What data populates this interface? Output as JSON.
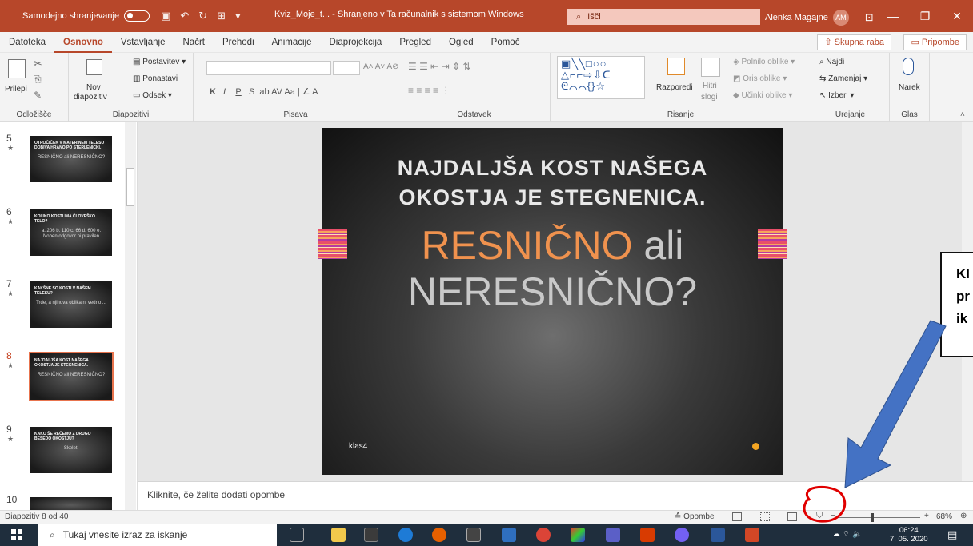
{
  "titlebar": {
    "autosave_label": "Samodejno shranjevanje",
    "doc_title": "Kviz_Moje_t... - Shranjeno v Ta računalnik s sistemom Windows",
    "search_placeholder": "Išči",
    "user_name": "Alenka Magajne",
    "user_initials": "AM"
  },
  "tabs": [
    "Datoteka",
    "Osnovno",
    "Vstavljanje",
    "Načrt",
    "Prehodi",
    "Animacije",
    "Diaprojekcija",
    "Pregled",
    "Ogled",
    "Pomoč"
  ],
  "active_tab": "Osnovno",
  "share_label": "Skupna raba",
  "comments_label": "Pripombe",
  "ribbon": {
    "clipboard": {
      "paste": "Prilepi",
      "label": "Odložišče"
    },
    "slides": {
      "new_slide": "Nov",
      "new_slide2": "diapozitiv",
      "layout": "Postavitev",
      "reset": "Ponastavi",
      "section": "Odsek",
      "label": "Diapozitivi"
    },
    "font": {
      "label": "Pisava",
      "bold": "K",
      "italic": "L",
      "underline": "P",
      "strike": "S"
    },
    "paragraph": {
      "label": "Odstavek"
    },
    "drawing": {
      "arrange": "Razporedi",
      "quick_styles": "Hitri",
      "quick_styles2": "slogi",
      "fill": "Polnilo oblike",
      "outline": "Oris oblike",
      "effects": "Učinki oblike",
      "label": "Risanje"
    },
    "editing": {
      "find": "Najdi",
      "replace": "Zamenjaj",
      "select": "Izberi",
      "label": "Urejanje"
    },
    "voice": {
      "dictate": "Narek",
      "label": "Glas"
    }
  },
  "thumbnails": [
    {
      "num": "5",
      "text": "OTROČIČEK V MATERINEM TELESU DOBIVA HRANO PO STERLENIČKI.",
      "sub": "RESNIČNO ali NERESNIČNO?"
    },
    {
      "num": "6",
      "text": "KOLIKO KOSTI IMA ČLOVEŠKO TELO?",
      "sub": "a. 206 b. 110 c. 66 d. 600 e. Noben odgovor ni pravilen"
    },
    {
      "num": "7",
      "text": "KAKŠNE SO KOSTI V NAŠEM TELESU?",
      "sub": "Trde, a njihova oblika ni vedno ..."
    },
    {
      "num": "8",
      "text": "NAJDALJŠA KOST NAŠEGA OKOSTJA JE STEGNENICA.",
      "sub": "RESNIČNO ali NERESNIČNO?"
    },
    {
      "num": "9",
      "text": "KAKO ŠE REČEMO Z DRUGO BESEDO OKOSTJU?",
      "sub": "Skelet."
    },
    {
      "num": "10",
      "text": "",
      "sub": ""
    }
  ],
  "slide": {
    "title_line1": "NAJDALJŠA KOST NAŠEGA",
    "title_line2": "OKOSTJA JE STEGNENICA.",
    "answer_true": "RESNIČNO",
    "answer_or": " ali",
    "answer_false": "NERESNIČNO?",
    "footer": "klas4"
  },
  "callout_lines": [
    "Kl",
    "pr",
    "ik"
  ],
  "notes_placeholder": "Kliknite, če želite dodati opombe",
  "status": {
    "slide_count": "Diapozitiv 8 od 40",
    "notes_button": "Opombe",
    "zoom": "68%",
    "zoom_fraction": 0.42
  },
  "taskbar": {
    "search_placeholder": "Tukaj vnesite izraz za iskanje",
    "time": "06:24",
    "date": "7. 05. 2020"
  },
  "colors": {
    "accent": "#b7472a",
    "orange_text": "#f0924e",
    "annotation_red": "#e00000",
    "arrow_blue": "#4472c4"
  }
}
